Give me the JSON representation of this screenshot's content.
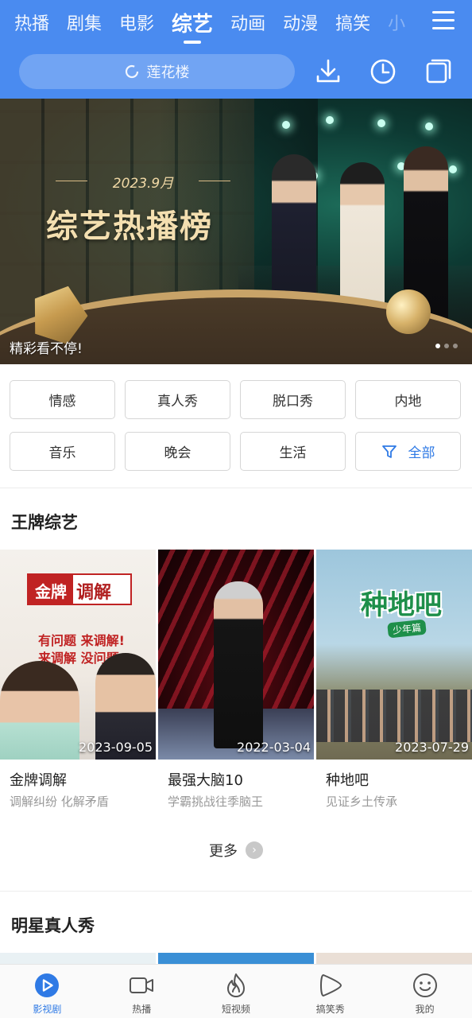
{
  "top_tabs": [
    {
      "label": "热播"
    },
    {
      "label": "剧集"
    },
    {
      "label": "电影"
    },
    {
      "label": "综艺",
      "active": true
    },
    {
      "label": "动画"
    },
    {
      "label": "动漫"
    },
    {
      "label": "搞笑"
    },
    {
      "label": "小"
    }
  ],
  "header": {
    "search_placeholder": "莲花楼",
    "menu_icon": "menu-icon",
    "download_icon": "download-icon",
    "history_icon": "history-icon",
    "window_icon": "window-icon",
    "accent": "#4a8bf0"
  },
  "banner": {
    "date": "2023.9月",
    "headline": "综艺热播榜",
    "caption": "精彩看不停!",
    "dots_active": 1,
    "dots_total": 3
  },
  "filters": [
    {
      "label": "情感"
    },
    {
      "label": "真人秀"
    },
    {
      "label": "脱口秀"
    },
    {
      "label": "内地"
    },
    {
      "label": "音乐"
    },
    {
      "label": "晚会"
    },
    {
      "label": "生活"
    },
    {
      "label": "全部",
      "icon": "filter-icon"
    }
  ],
  "sections": {
    "ace": {
      "title": "王牌综艺",
      "cards": [
        {
          "date": "2023-09-05",
          "title": "金牌调解",
          "subtitle": "调解纠纷 化解矛盾",
          "poster_logo_a": "金牌",
          "poster_logo_b": "调解",
          "poster_slogan_1": "有问题 来调解!",
          "poster_slogan_2": "来调解 没问题!"
        },
        {
          "date": "2022-03-04",
          "title": "最强大脑10",
          "subtitle": "学霸挑战往季脑王"
        },
        {
          "date": "2023-07-29",
          "title": "种地吧",
          "subtitle": "见证乡土传承",
          "poster_logo": "种地吧",
          "poster_badge": "少年篇"
        }
      ],
      "more_label": "更多"
    },
    "star": {
      "title": "明星真人秀"
    }
  },
  "bottom_nav": [
    {
      "label": "影视剧",
      "icon": "play-circle-icon",
      "active": true
    },
    {
      "label": "热播",
      "icon": "video-camera-icon"
    },
    {
      "label": "短视频",
      "icon": "flame-icon"
    },
    {
      "label": "搞笑秀",
      "icon": "play-triangle-icon"
    },
    {
      "label": "我的",
      "icon": "smile-icon"
    }
  ]
}
